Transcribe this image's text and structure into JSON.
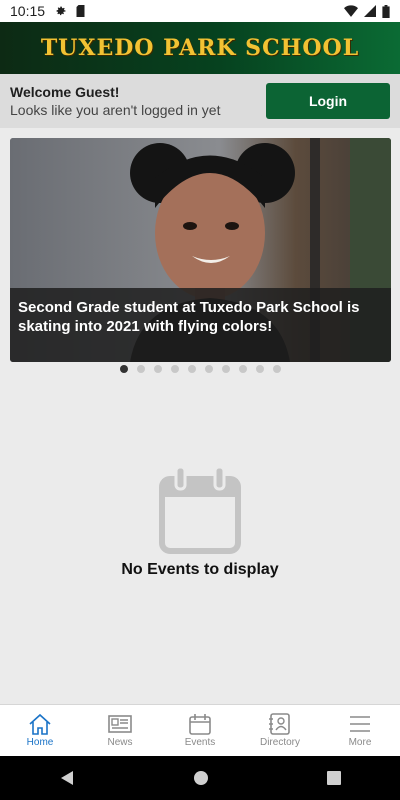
{
  "status_bar": {
    "time": "10:15"
  },
  "header": {
    "title": "TUXEDO PARK SCHOOL"
  },
  "login": {
    "welcome": "Welcome Guest!",
    "subtitle": "Looks like you aren't logged in yet",
    "button_label": "Login"
  },
  "carousel": {
    "caption": "Second Grade student at Tuxedo Park School is skating into 2021 with flying colors!",
    "total_slides": 10,
    "active_index": 0
  },
  "events": {
    "empty_message": "No Events to display"
  },
  "nav": {
    "items": [
      {
        "label": "Home",
        "icon": "home-icon"
      },
      {
        "label": "News",
        "icon": "news-icon"
      },
      {
        "label": "Events",
        "icon": "calendar-icon"
      },
      {
        "label": "Directory",
        "icon": "directory-icon"
      },
      {
        "label": "More",
        "icon": "menu-icon"
      }
    ],
    "active": "Home"
  },
  "colors": {
    "brand_green": "#0c6434",
    "title_gold": "#f2c233",
    "nav_active": "#1a73c7"
  }
}
